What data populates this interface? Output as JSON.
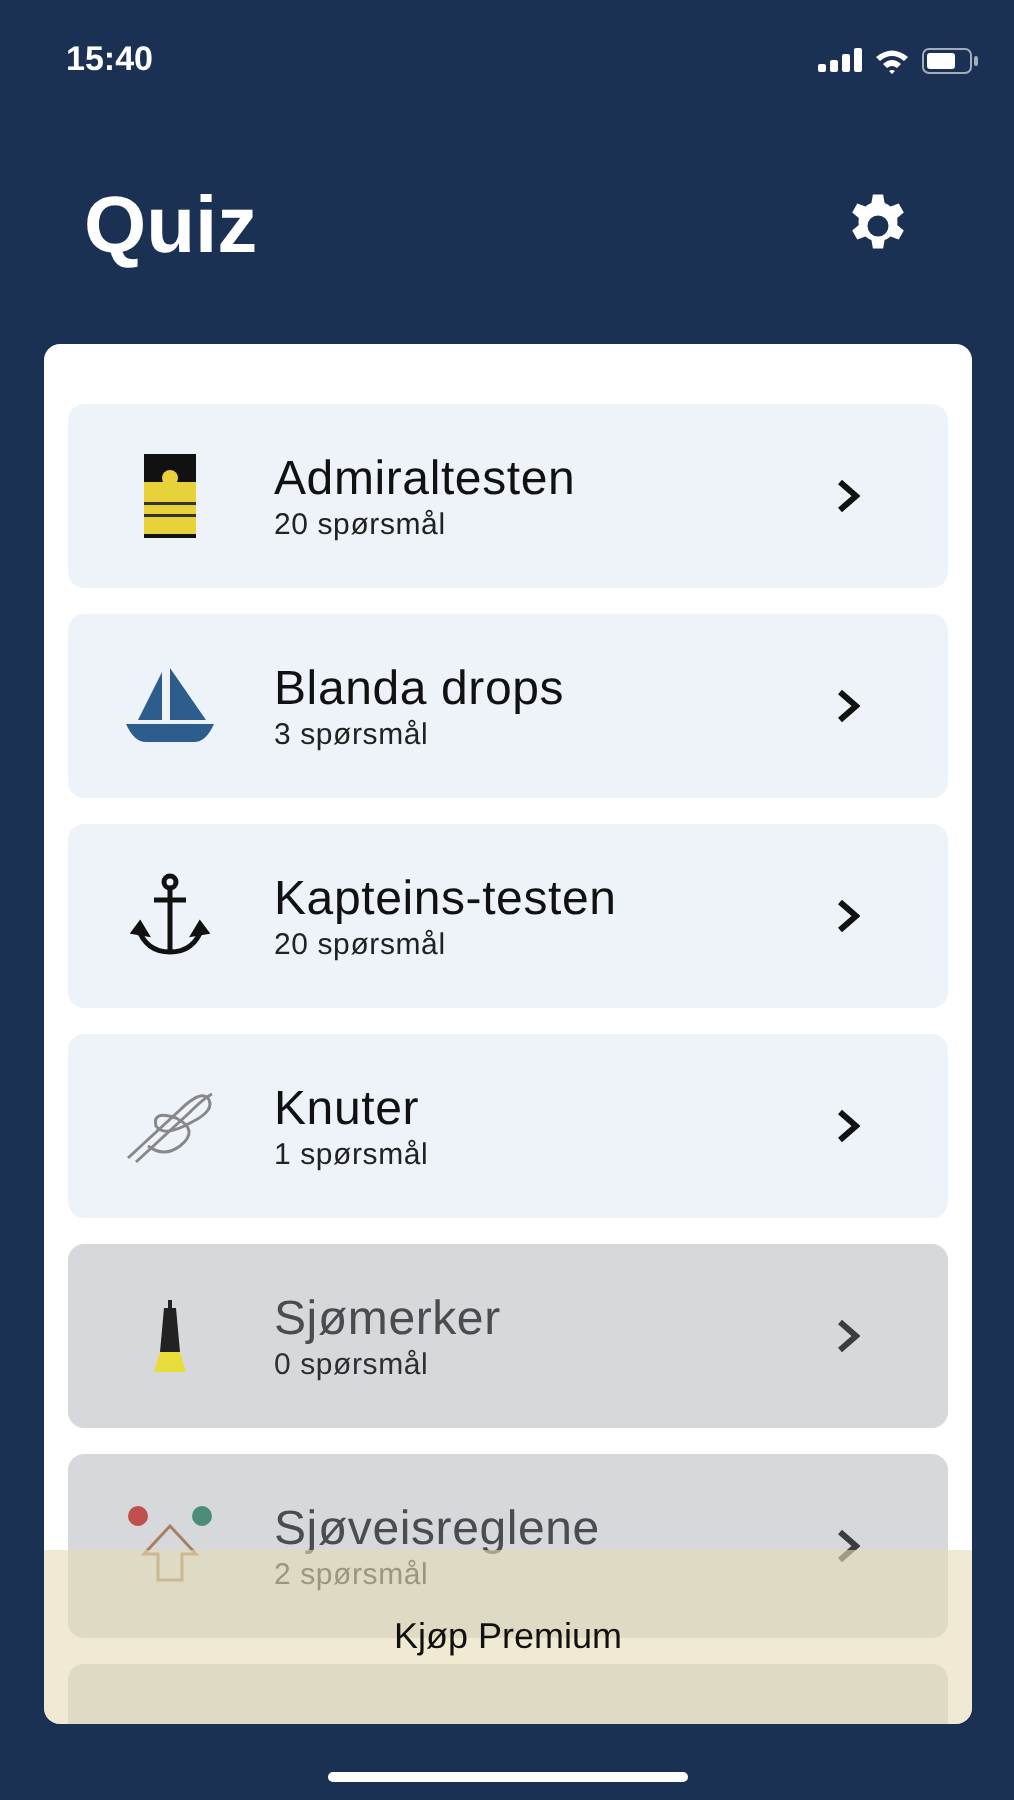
{
  "status_bar": {
    "time": "15:40"
  },
  "title": "Quiz",
  "quizzes": [
    {
      "kind": "epaulette",
      "title": "Admiraltesten",
      "subtitle": "20 spørsmål",
      "locked": false
    },
    {
      "kind": "sailboat",
      "title": "Blanda drops",
      "subtitle": "3 spørsmål",
      "locked": false
    },
    {
      "kind": "anchor",
      "title": "Kapteins-testen",
      "subtitle": "20 spørsmål",
      "locked": false
    },
    {
      "kind": "knot",
      "title": "Knuter",
      "subtitle": "1 spørsmål",
      "locked": false
    },
    {
      "kind": "buoy",
      "title": "Sjømerker",
      "subtitle": "0 spørsmål",
      "locked": true
    },
    {
      "kind": "rules",
      "title": "Sjøveisreglene",
      "subtitle": "2 spørsmål",
      "locked": true
    }
  ],
  "premium_banner": {
    "label": "Kjøp Premium"
  }
}
